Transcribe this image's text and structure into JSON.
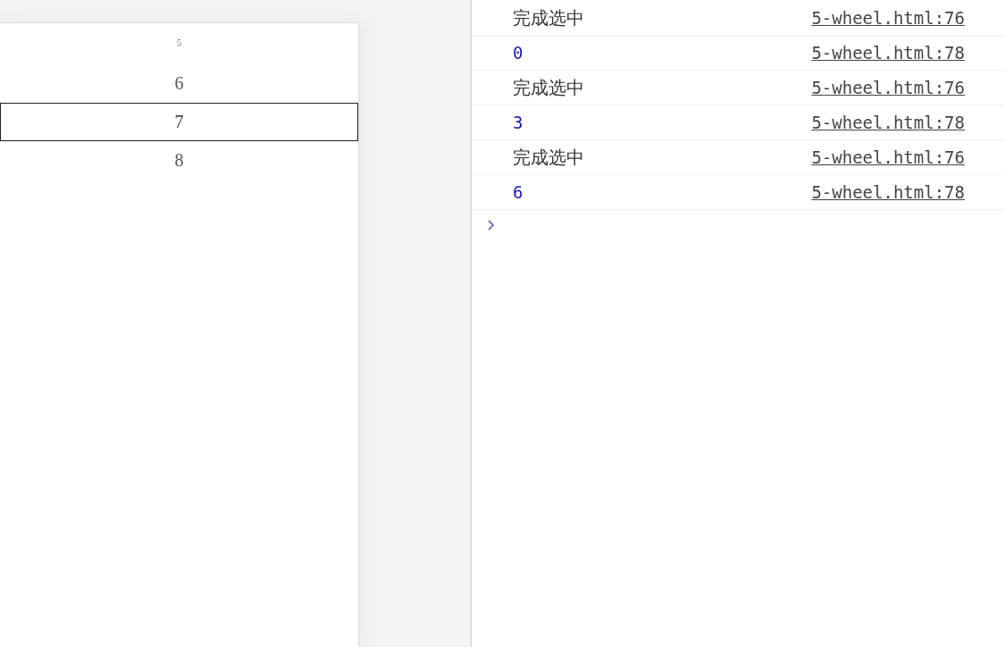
{
  "wheel": {
    "items": [
      {
        "label": "5",
        "selected": false,
        "kind": "edge"
      },
      {
        "label": "6",
        "selected": false,
        "kind": "normal"
      },
      {
        "label": "7",
        "selected": true,
        "kind": "normal"
      },
      {
        "label": "8",
        "selected": false,
        "kind": "normal"
      }
    ]
  },
  "console": {
    "messages": [
      {
        "text": "完成选中",
        "kind": "string",
        "source": "5-wheel.html:76"
      },
      {
        "text": "0",
        "kind": "number",
        "source": "5-wheel.html:78"
      },
      {
        "text": "完成选中",
        "kind": "string",
        "source": "5-wheel.html:76"
      },
      {
        "text": "3",
        "kind": "number",
        "source": "5-wheel.html:78"
      },
      {
        "text": "完成选中",
        "kind": "string",
        "source": "5-wheel.html:76"
      },
      {
        "text": "6",
        "kind": "number",
        "source": "5-wheel.html:78"
      }
    ]
  }
}
